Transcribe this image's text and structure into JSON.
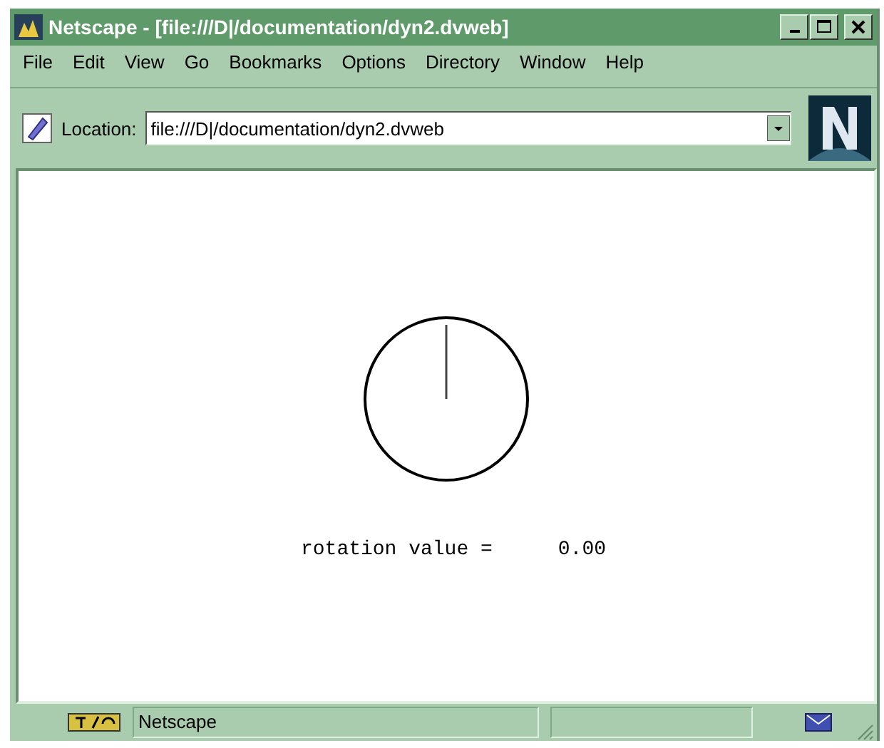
{
  "window": {
    "title": "Netscape - [file:///D|/documentation/dyn2.dvweb]"
  },
  "menu": [
    "File",
    "Edit",
    "View",
    "Go",
    "Bookmarks",
    "Options",
    "Directory",
    "Window",
    "Help"
  ],
  "location": {
    "label": "Location:",
    "value": "file:///D|/documentation/dyn2.dvweb"
  },
  "content": {
    "label": "rotation value =",
    "value": "0.00"
  },
  "status_bar": {
    "text": "Netscape"
  }
}
